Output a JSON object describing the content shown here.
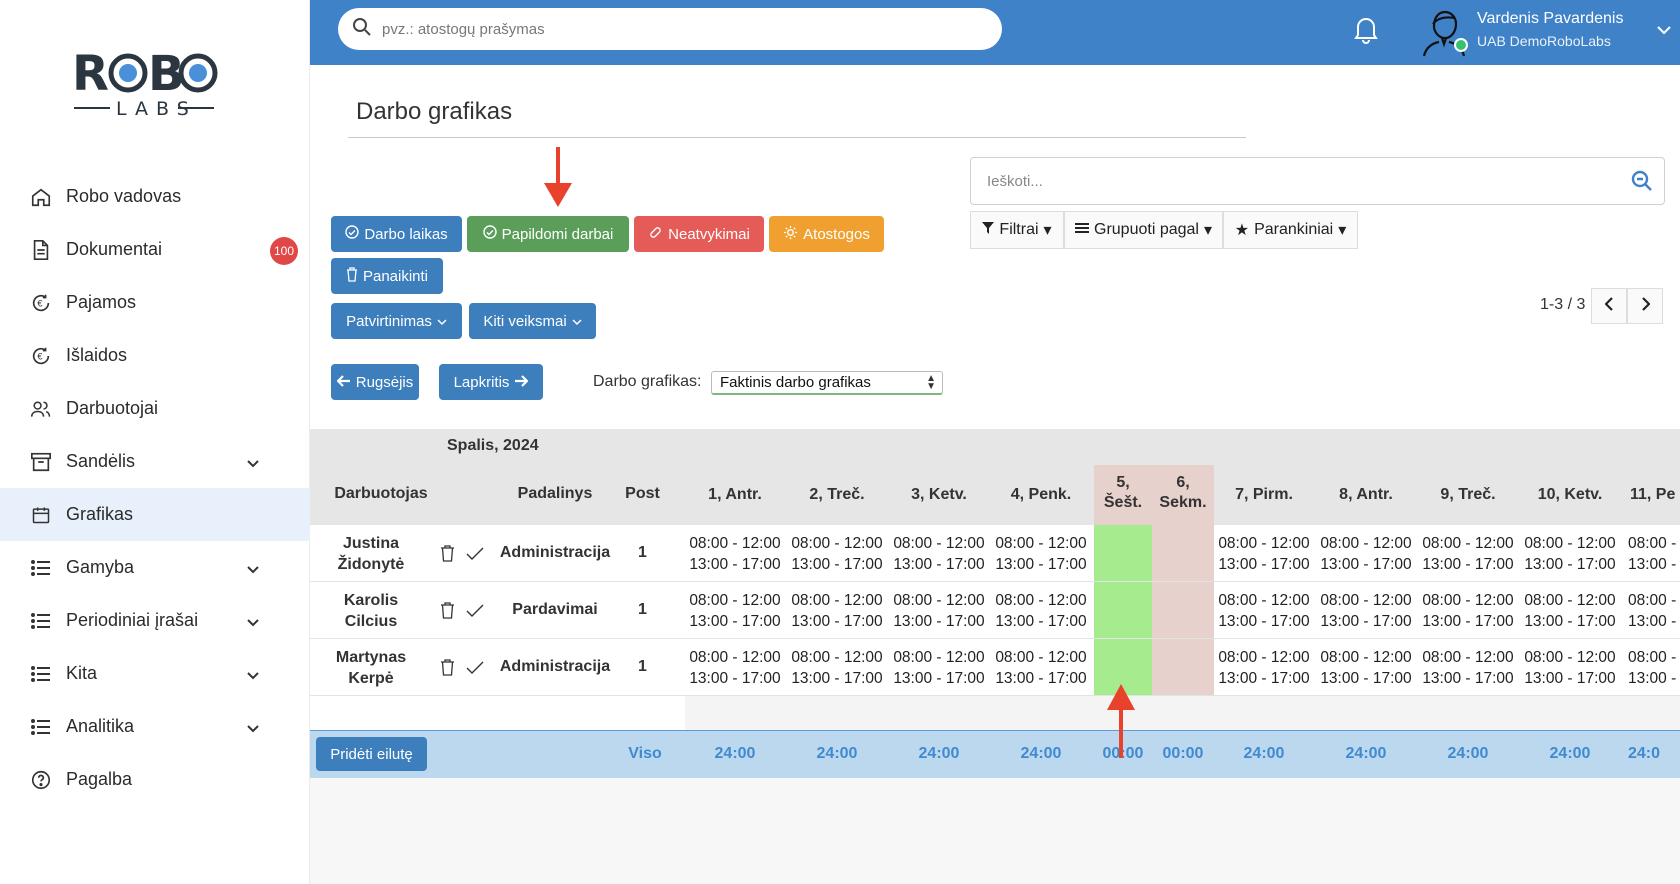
{
  "brand": {
    "logo_top": "ROBO",
    "logo_bottom": "LABS"
  },
  "sidebar": {
    "items": [
      {
        "label": "Robo vadovas",
        "icon": "home-icon",
        "active": false,
        "expandable": false
      },
      {
        "label": "Dokumentai",
        "icon": "document-icon",
        "active": false,
        "expandable": false,
        "badge": "100"
      },
      {
        "label": "Pajamos",
        "icon": "income-icon",
        "active": false,
        "expandable": false
      },
      {
        "label": "Išlaidos",
        "icon": "expense-icon",
        "active": false,
        "expandable": false
      },
      {
        "label": "Darbuotojai",
        "icon": "people-icon",
        "active": false,
        "expandable": false
      },
      {
        "label": "Sandėlis",
        "icon": "archive-icon",
        "active": false,
        "expandable": true
      },
      {
        "label": "Grafikas",
        "icon": "calendar-icon",
        "active": true,
        "expandable": false
      },
      {
        "label": "Gamyba",
        "icon": "list-icon",
        "active": false,
        "expandable": true
      },
      {
        "label": "Periodiniai įrašai",
        "icon": "list-icon",
        "active": false,
        "expandable": true
      },
      {
        "label": "Kita",
        "icon": "list-icon",
        "active": false,
        "expandable": true
      },
      {
        "label": "Analitika",
        "icon": "list-icon",
        "active": false,
        "expandable": true
      },
      {
        "label": "Pagalba",
        "icon": "help-icon",
        "active": false,
        "expandable": false
      }
    ]
  },
  "topbar": {
    "search_placeholder": "pvz.: atostogų prašymas",
    "user_name": "Vardenis Pavardenis",
    "user_company": "UAB DemoRoboLabs"
  },
  "page": {
    "title": "Darbo grafikas",
    "search_placeholder": "Ieškoti...",
    "filters_label": "Filtrai",
    "group_label": "Grupuoti pagal",
    "favorites_label": "Parankiniai",
    "pager": "1-3 / 3"
  },
  "actions": {
    "work_time": "Darbo laikas",
    "extra_work": "Papildomi darbai",
    "absences": "Neatvykimai",
    "vacations": "Atostogos",
    "delete": "Panaikinti",
    "confirmation": "Patvirtinimas",
    "other_actions": "Kiti veiksmai",
    "prev_month": "Rugsėjis",
    "next_month": "Lapkritis",
    "schedule_label": "Darbo grafikas:",
    "schedule_value": "Faktinis darbo grafikas"
  },
  "colors": {
    "topbar": "#3f82c8",
    "primary": "#3d7ebd",
    "success": "#5b9e5a",
    "danger": "#e45b57",
    "warning": "#f0a030",
    "weekend": "#e6d1cc",
    "extra_work_cell": "#a6eb8d",
    "annotation_arrow": "#e8412c"
  },
  "table": {
    "month": "Spalis, 2024",
    "headers": {
      "employee": "Darbuotojas",
      "department": "Padalinys",
      "post": "Post",
      "days": [
        [
          "1, Antr."
        ],
        [
          "2, Treč."
        ],
        [
          "3, Ketv."
        ],
        [
          "4, Penk."
        ],
        [
          "5,",
          "Šešt."
        ],
        [
          "6,",
          "Sekm."
        ],
        [
          "7, Pirm."
        ],
        [
          "8, Antr."
        ],
        [
          "9, Treč."
        ],
        [
          "10, Ketv."
        ],
        [
          "11, Pe"
        ]
      ]
    },
    "rows": [
      {
        "first": "Justina",
        "last": "Židonytė",
        "department": "Administracija",
        "post": "1"
      },
      {
        "first": "Karolis",
        "last": "Cilcius",
        "department": "Pardavimai",
        "post": "1"
      },
      {
        "first": "Martynas",
        "last": "Kerpė",
        "department": "Administracija",
        "post": "1"
      }
    ],
    "shift_line1": "08:00 - 12:00",
    "shift_line2": "13:00 - 17:00",
    "shift_line1_cut": "08:00 -",
    "shift_line2_cut": "13:00 -",
    "add_row": "Pridėti eilutę",
    "total_label": "Viso",
    "totals": [
      "24:00",
      "24:00",
      "24:00",
      "24:00",
      "00:00",
      "00:00",
      "24:00",
      "24:00",
      "24:00",
      "24:00",
      "24:0"
    ]
  }
}
